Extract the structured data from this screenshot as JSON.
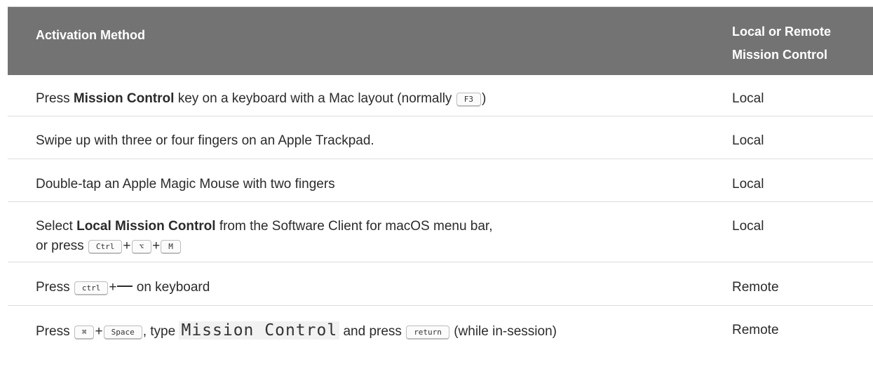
{
  "table": {
    "headers": {
      "method": "Activation Method",
      "scope_line1": "Local or Remote",
      "scope_line2": "Mission Control"
    },
    "rows": [
      {
        "pre": "Press ",
        "bold": "Mission Control",
        "post": " key on a keyboard with a Mac layout (normally ",
        "key": "F3",
        "end": ")",
        "scope": "Local"
      },
      {
        "text": "Swipe up with three or four fingers on an Apple Trackpad.",
        "scope": "Local"
      },
      {
        "text": "Double-tap an Apple Magic Mouse with two fingers",
        "scope": "Local"
      },
      {
        "pre": "Select ",
        "bold": "Local Mission Control",
        "post": " from the Software Client for macOS menu bar,",
        "line2_pre": "or press ",
        "keys": [
          "Ctrl",
          "⌥",
          "M"
        ],
        "plus": "+",
        "scope": "Local"
      },
      {
        "pre": "Press ",
        "key": "ctrl",
        "plus": "+",
        "post": " on keyboard",
        "scope": "Remote"
      },
      {
        "pre": "Press ",
        "key1": "⌘",
        "plus": "+",
        "key2": "Space",
        "mid": ", type ",
        "code": "Mission Control",
        "mid2": " and press ",
        "key3": "return",
        "post": " (while in-session)",
        "scope": "Remote"
      }
    ]
  },
  "colors": {
    "header_bg": "#737373",
    "header_text": "#ffffff",
    "row_border": "#dcdcdc",
    "text": "#2b2b2b"
  }
}
